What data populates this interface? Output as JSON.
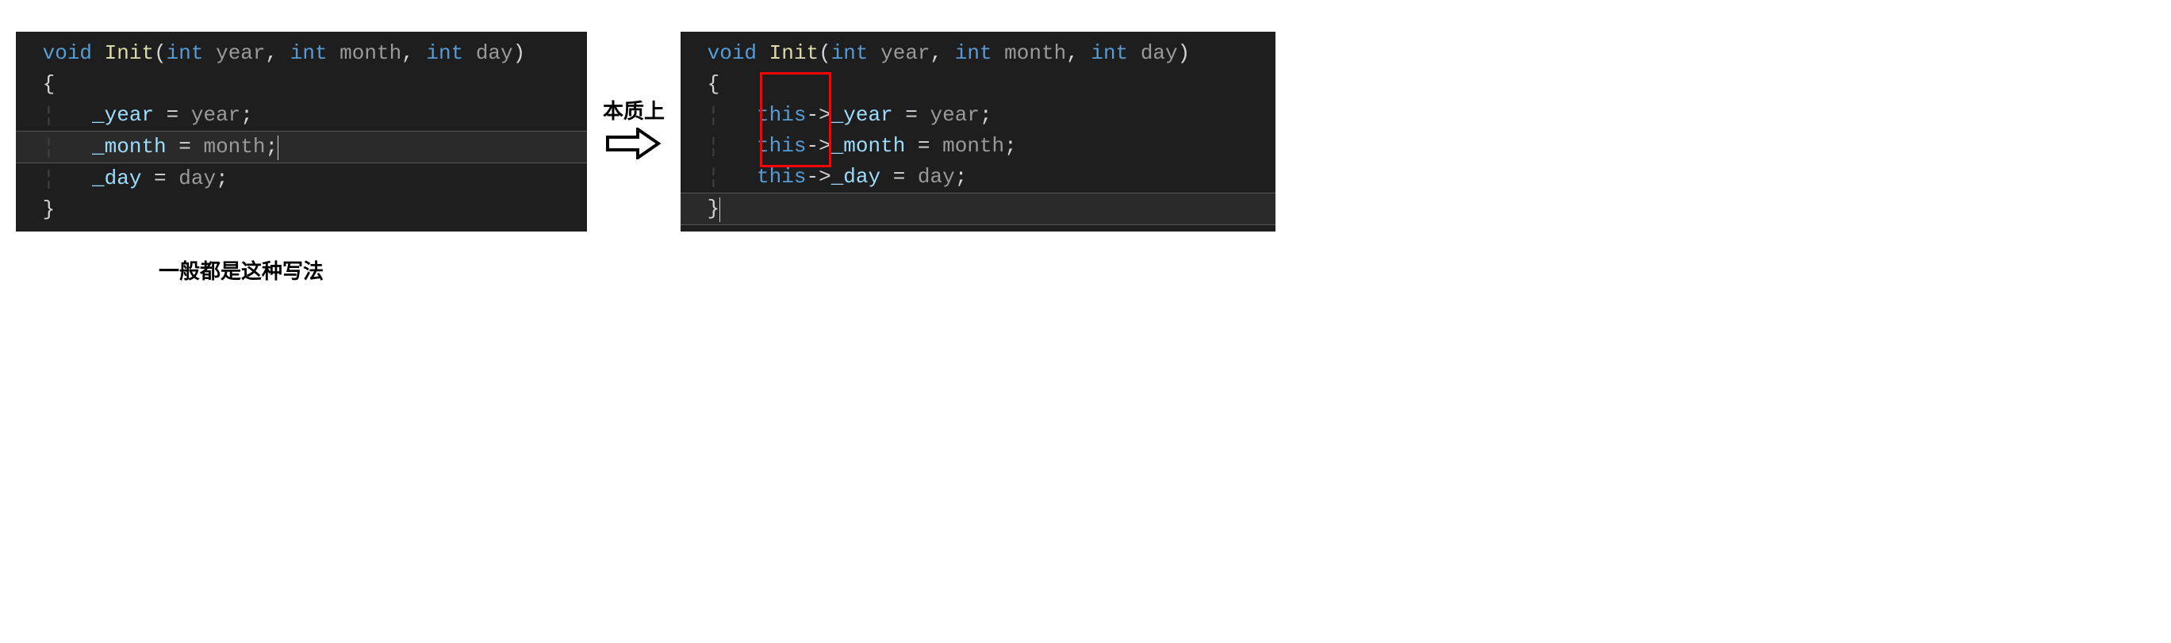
{
  "left_code": {
    "sig": {
      "ret": "void",
      "name": "Init",
      "p1_type": "int",
      "p1_name": "year",
      "p2_type": "int",
      "p2_name": "month",
      "p3_type": "int",
      "p3_name": "day",
      "open": "{",
      "close": "}"
    },
    "body": {
      "l1_member": "_year",
      "l1_eq": " = ",
      "l1_param": "year",
      "l1_semi": ";",
      "l2_member": "_month",
      "l2_eq": " = ",
      "l2_param": "month",
      "l2_semi": ";",
      "l3_member": "_day",
      "l3_eq": " = ",
      "l3_param": "day",
      "l3_semi": ";"
    }
  },
  "right_code": {
    "sig": {
      "ret": "void",
      "name": "Init",
      "p1_type": "int",
      "p1_name": "year",
      "p2_type": "int",
      "p2_name": "month",
      "p3_type": "int",
      "p3_name": "day",
      "open": "{",
      "close": "}"
    },
    "body": {
      "this": "this",
      "arrow": "->",
      "l1_member": "_year",
      "l1_eq": " = ",
      "l1_param": "year",
      "l1_semi": ";",
      "l2_member": "_month",
      "l2_eq": " = ",
      "l2_param": "month",
      "l2_semi": ";",
      "l3_member": "_day",
      "l3_eq": " = ",
      "l3_param": "day",
      "l3_semi": ";"
    }
  },
  "arrow_label": "本质上",
  "caption": "一般都是这种写法"
}
